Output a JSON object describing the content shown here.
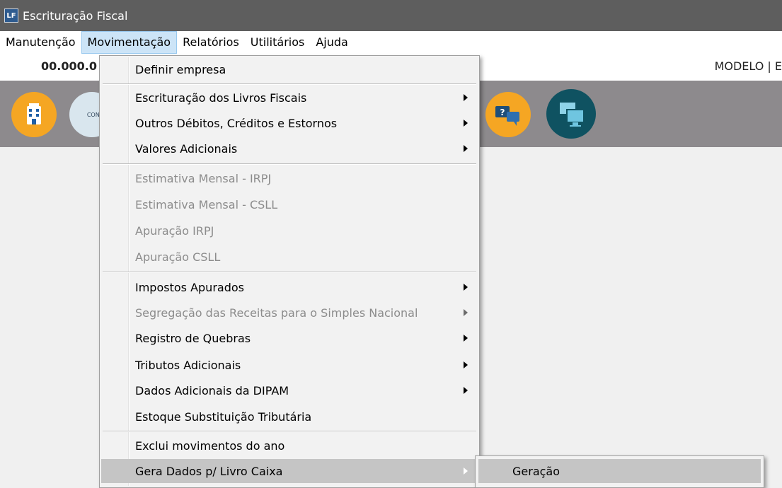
{
  "window": {
    "title": "Escrituração Fiscal",
    "icon_text": "LF"
  },
  "menubar": {
    "items": [
      {
        "label": "Manutenção"
      },
      {
        "label": "Movimentação"
      },
      {
        "label": "Relatórios"
      },
      {
        "label": "Utilitários"
      },
      {
        "label": "Ajuda"
      }
    ]
  },
  "infobar": {
    "company_code": "00.000.0",
    "model_text": "MODELO | E"
  },
  "toolbar": {
    "icons": [
      {
        "name": "company-building-icon",
        "color": "#f5a623"
      },
      {
        "name": "contract-icon",
        "color": "#d9e6ee",
        "text": "CONTR"
      },
      {
        "name": "help-chat-icon",
        "color": "#f5a623"
      },
      {
        "name": "remote-screens-icon",
        "color": "#0f5261"
      }
    ]
  },
  "menu": {
    "items": [
      {
        "label": "Definir empresa",
        "submenu": false,
        "disabled": false
      },
      {
        "label": "Escrituração dos Livros Fiscais",
        "submenu": true,
        "disabled": false
      },
      {
        "label": "Outros Débitos, Créditos e Estornos",
        "submenu": true,
        "disabled": false
      },
      {
        "label": "Valores Adicionais",
        "submenu": true,
        "disabled": false
      },
      {
        "label": "Estimativa Mensal - IRPJ",
        "submenu": false,
        "disabled": true
      },
      {
        "label": "Estimativa Mensal - CSLL",
        "submenu": false,
        "disabled": true
      },
      {
        "label": "Apuração IRPJ",
        "submenu": false,
        "disabled": true
      },
      {
        "label": "Apuração CSLL",
        "submenu": false,
        "disabled": true
      },
      {
        "label": "Impostos Apurados",
        "submenu": true,
        "disabled": false
      },
      {
        "label": "Segregação das Receitas para o Simples Nacional",
        "submenu": true,
        "disabled": true
      },
      {
        "label": "Registro de Quebras",
        "submenu": true,
        "disabled": false
      },
      {
        "label": "Tributos Adicionais",
        "submenu": true,
        "disabled": false
      },
      {
        "label": "Dados Adicionais da DIPAM",
        "submenu": true,
        "disabled": false
      },
      {
        "label": "Estoque Substituição Tributária",
        "submenu": false,
        "disabled": false
      },
      {
        "label": "Exclui movimentos do ano",
        "submenu": false,
        "disabled": false
      },
      {
        "label": "Gera Dados p/ Livro Caixa",
        "submenu": true,
        "disabled": false,
        "highlighted": true
      }
    ]
  },
  "submenu": {
    "items": [
      {
        "label": "Geração",
        "highlighted": true
      }
    ]
  }
}
